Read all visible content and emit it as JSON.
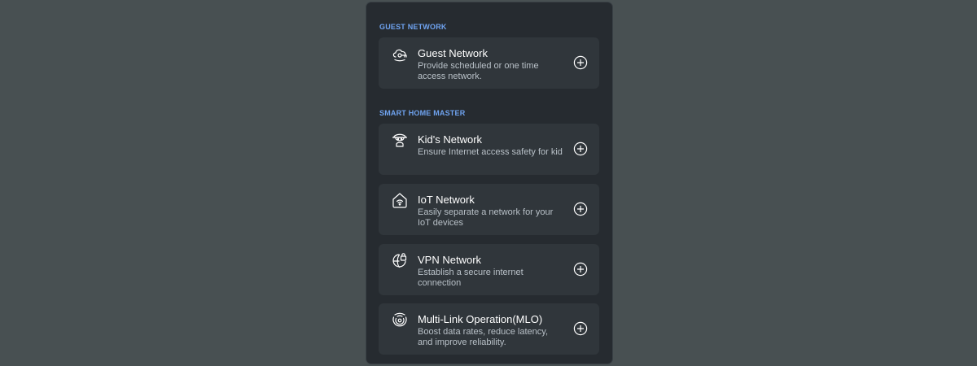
{
  "sections": [
    {
      "title": "GUEST NETWORK",
      "items": [
        {
          "title": "Guest Network",
          "desc": "Provide scheduled or one time access network.",
          "icon": "guest-network-icon"
        }
      ]
    },
    {
      "title": "SMART HOME MASTER",
      "items": [
        {
          "title": "Kid's Network",
          "desc": "Ensure Internet access safety for kid",
          "icon": "kids-network-icon"
        },
        {
          "title": "IoT Network",
          "desc": "Easily separate a network for your IoT devices",
          "icon": "iot-network-icon"
        },
        {
          "title": "VPN Network",
          "desc": "Establish a secure internet connection",
          "icon": "vpn-network-icon"
        },
        {
          "title": "Multi-Link Operation(MLO)",
          "desc": "Boost data rates, reduce latency, and improve reliability.",
          "icon": "mlo-icon"
        }
      ]
    }
  ],
  "colors": {
    "background": "#485052",
    "panel": "#262b30",
    "card": "#30363b",
    "section_title": "#6fa3f0",
    "title": "#ffffff",
    "desc": "#b8c0c7"
  }
}
